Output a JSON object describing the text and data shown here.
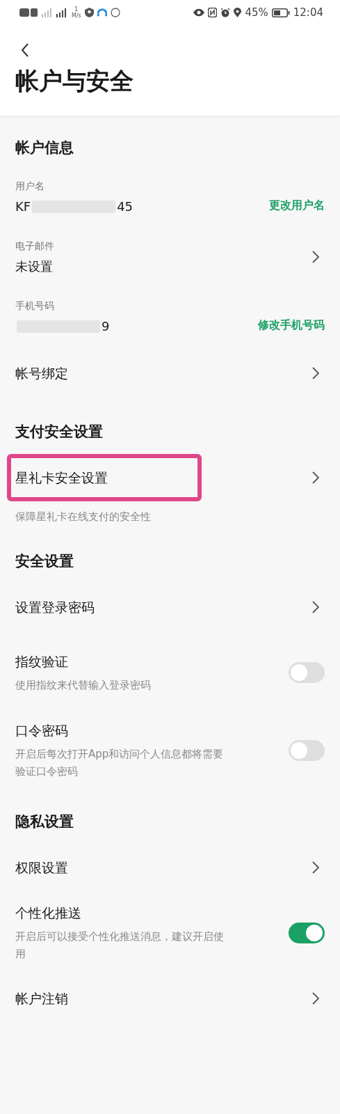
{
  "status_bar": {
    "speed": "1",
    "speed_unit": "M/s",
    "battery": "45%",
    "time": "12:04"
  },
  "title": "帐户与安全",
  "sections": [
    {
      "title": "帐户信息",
      "items": [
        {
          "kind": "field_action",
          "label": "用户名",
          "value_start": "KF",
          "value_end": "45",
          "action": "更改用户名"
        },
        {
          "kind": "field_link",
          "label": "电子邮件",
          "value": "未设置"
        },
        {
          "kind": "field_action",
          "label": "手机号码",
          "value_end": "9",
          "action": "修改手机号码"
        },
        {
          "kind": "link",
          "label": "帐号绑定"
        }
      ]
    },
    {
      "title": "支付安全设置",
      "items": [
        {
          "kind": "link",
          "label": "星礼卡安全设置",
          "note": "保障星礼卡在线支付的安全性",
          "highlighted": true
        }
      ]
    },
    {
      "title": "安全设置",
      "items": [
        {
          "kind": "link",
          "label": "设置登录密码"
        },
        {
          "kind": "toggle",
          "label": "指纹验证",
          "note": "使用指纹来代替输入登录密码",
          "on": false
        },
        {
          "kind": "toggle",
          "label": "口令密码",
          "note": "开启后每次打开App和访问个人信息都将需要验证口令密码",
          "on": false
        }
      ]
    },
    {
      "title": "隐私设置",
      "items": [
        {
          "kind": "link",
          "label": "权限设置"
        },
        {
          "kind": "toggle",
          "label": "个性化推送",
          "note": "开启后可以接受个性化推送消息，建议开启使用",
          "on": true
        },
        {
          "kind": "link",
          "label": "帐户注销"
        }
      ]
    }
  ]
}
